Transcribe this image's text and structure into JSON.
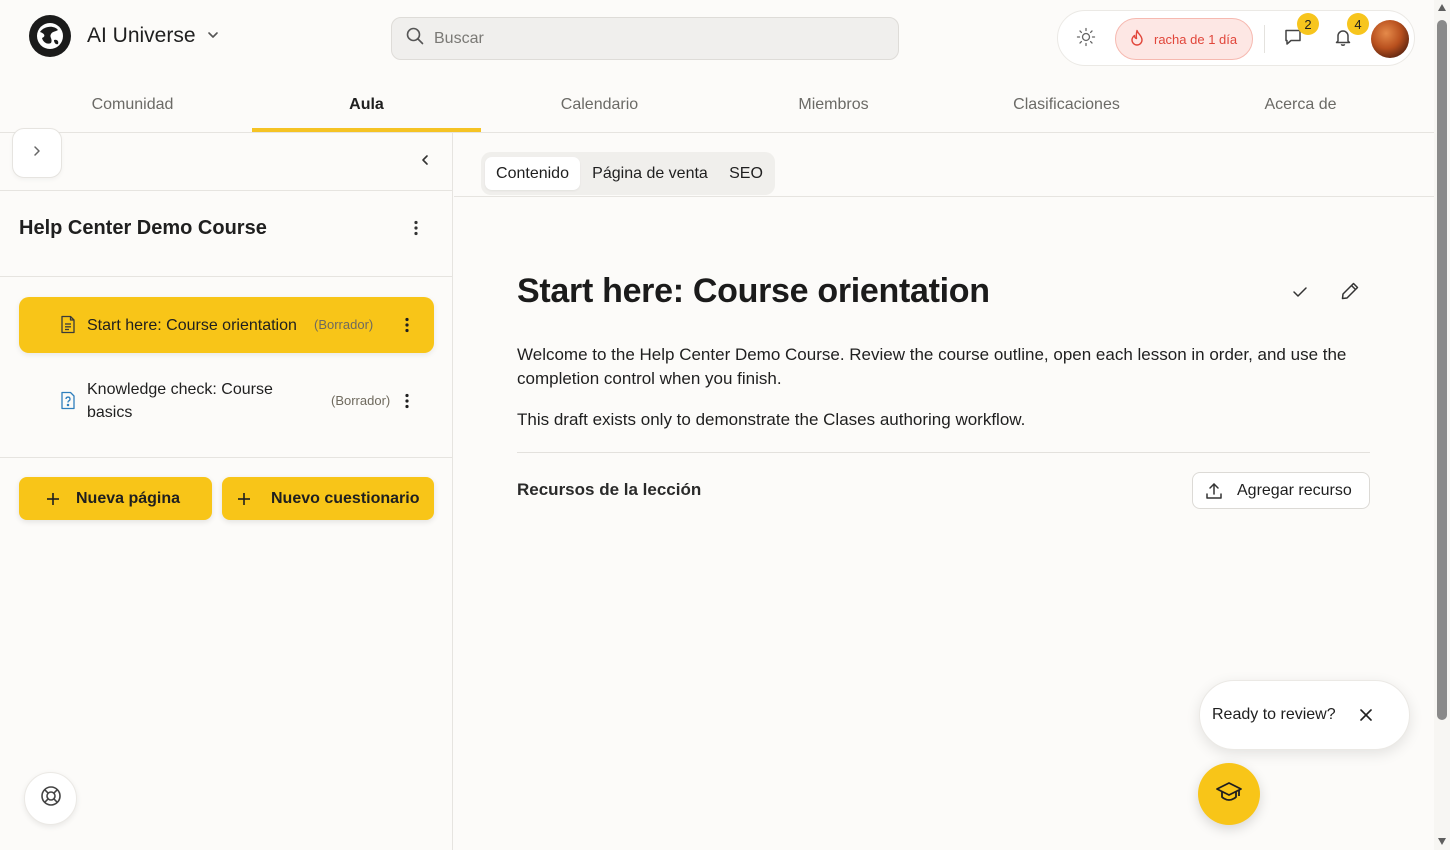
{
  "header": {
    "community_name": "AI Universe",
    "search_placeholder": "Buscar",
    "streak_label": "racha de 1 día",
    "chat_badge": "2",
    "notifications_badge": "4",
    "accent_color": "#f8c518"
  },
  "nav": {
    "items": [
      {
        "label": "Comunidad",
        "active": false
      },
      {
        "label": "Aula",
        "active": true
      },
      {
        "label": "Calendario",
        "active": false
      },
      {
        "label": "Miembros",
        "active": false
      },
      {
        "label": "Clasificaciones",
        "active": false
      },
      {
        "label": "Acerca de",
        "active": false
      }
    ]
  },
  "sidebar": {
    "course_title": "Help Center Demo Course",
    "lessons": [
      {
        "title": "Start here: Course orientation",
        "status": "(Borrador)",
        "icon": "page-icon",
        "active": true
      },
      {
        "title": "Knowledge check: Course basics",
        "title_line1": "Knowledge check: Course",
        "title_line2": "basics",
        "status": "(Borrador)",
        "icon": "quiz-icon",
        "active": false
      }
    ],
    "new_page_label": "Nueva página",
    "new_quiz_label": "Nuevo cuestionario"
  },
  "content": {
    "tabs": [
      {
        "label": "Contenido",
        "active": true
      },
      {
        "label": "Página de venta",
        "active": false
      },
      {
        "label": "SEO",
        "active": false
      }
    ],
    "lesson_title": "Start here: Course orientation",
    "paragraph_1": "Welcome to the Help Center Demo Course. Review the course outline, open each lesson in order, and use the completion control when you finish.",
    "paragraph_2": "This draft exists only to demonstrate the Clases authoring workflow.",
    "resources_title": "Recursos de la lección",
    "add_resource_label": "Agregar recurso"
  },
  "review": {
    "prompt": "Ready to review?"
  }
}
